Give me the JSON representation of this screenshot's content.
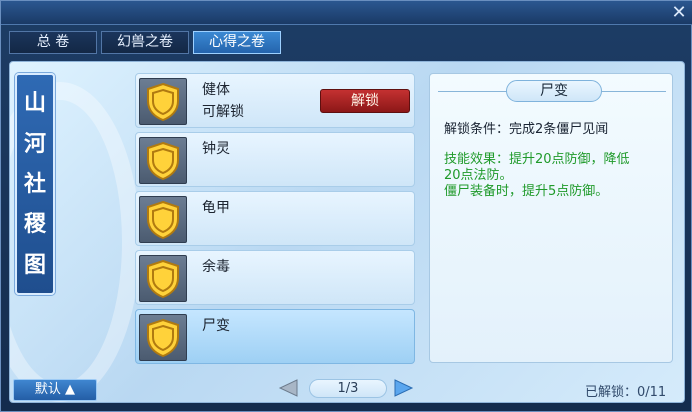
{
  "window": {
    "close_label": "✕"
  },
  "tabs": [
    {
      "label": "总 卷",
      "active": false
    },
    {
      "label": "幻兽之卷",
      "active": false
    },
    {
      "label": "心得之卷",
      "active": true
    }
  ],
  "seal": {
    "glyphs": [
      "山",
      "河",
      "社",
      "稷",
      "图"
    ]
  },
  "skills": [
    {
      "name": "健体",
      "status": "可解锁",
      "action_label": "解锁",
      "icon": "shield-icon",
      "selected": false
    },
    {
      "name": "钟灵",
      "status": "",
      "icon": "shield-icon",
      "selected": false
    },
    {
      "name": "龟甲",
      "status": "",
      "icon": "shield-icon",
      "selected": false
    },
    {
      "name": "余毒",
      "status": "",
      "icon": "shield-icon",
      "selected": false
    },
    {
      "name": "尸变",
      "status": "",
      "icon": "shield-icon",
      "selected": true
    }
  ],
  "detail": {
    "title": "尸变",
    "condition": "解锁条件：完成2条僵尸见闻",
    "effect_line1": "技能效果：提升20点防御，降低",
    "effect_line2": "20点法防。",
    "effect_line3": "僵尸装备时，提升5点防御。"
  },
  "footer": {
    "default_label": "默认 ▲",
    "page_indicator": "1/3",
    "unlocked_label": "已解锁：0/11"
  },
  "colors": {
    "accent": "#2f6ab4",
    "effect_text": "#1f9a2a",
    "unlock_button": "#b02424"
  }
}
